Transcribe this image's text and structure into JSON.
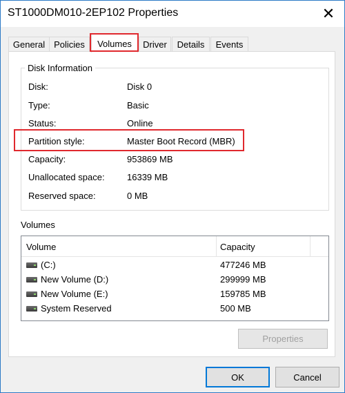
{
  "window": {
    "title": "ST1000DM010-2EP102 Properties",
    "close_glyph": "✕"
  },
  "tabs": [
    {
      "label": "General"
    },
    {
      "label": "Policies"
    },
    {
      "label": "Volumes",
      "active": true
    },
    {
      "label": "Driver"
    },
    {
      "label": "Details"
    },
    {
      "label": "Events"
    }
  ],
  "disk_info": {
    "group_label": "Disk Information",
    "rows": [
      {
        "label": "Disk:",
        "value": "Disk 0"
      },
      {
        "label": "Type:",
        "value": "Basic"
      },
      {
        "label": "Status:",
        "value": "Online"
      },
      {
        "label": "Partition style:",
        "value": "Master Boot Record (MBR)"
      },
      {
        "label": "Capacity:",
        "value": "953869 MB"
      },
      {
        "label": "Unallocated space:",
        "value": "16339 MB"
      },
      {
        "label": "Reserved space:",
        "value": "0 MB"
      }
    ]
  },
  "volumes": {
    "group_label": "Volumes",
    "columns": [
      "Volume",
      "Capacity"
    ],
    "items": [
      {
        "name": "(C:)",
        "capacity": "477246 MB",
        "icon": "drive-icon"
      },
      {
        "name": "New Volume (D:)",
        "capacity": "299999 MB",
        "icon": "drive-icon"
      },
      {
        "name": "New Volume (E:)",
        "capacity": "159785 MB",
        "icon": "drive-icon"
      },
      {
        "name": "System Reserved",
        "capacity": "500 MB",
        "icon": "drive-icon"
      }
    ],
    "properties_label": "Properties"
  },
  "footer": {
    "ok_label": "OK",
    "cancel_label": "Cancel"
  },
  "colors": {
    "highlight": "#e0282d",
    "accent": "#0078d7"
  }
}
